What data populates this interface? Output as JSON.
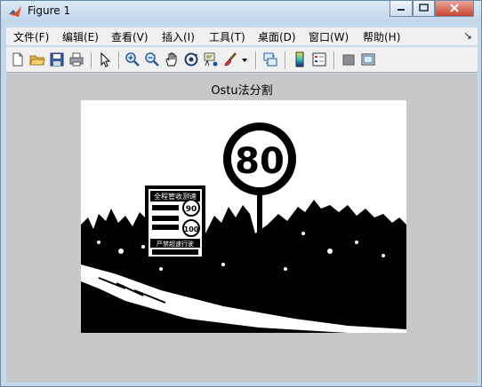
{
  "window": {
    "title": "Figure 1"
  },
  "menu": [
    "文件(F)",
    "编辑(E)",
    "查看(V)",
    "插入(I)",
    "工具(T)",
    "桌面(D)",
    "窗口(W)",
    "帮助(H)"
  ],
  "toolbar_icons": [
    "new-figure-icon",
    "open-file-icon",
    "save-icon",
    "print-icon",
    "edit-plot-icon",
    "zoom-in-icon",
    "zoom-out-icon",
    "pan-icon",
    "rotate-3d-icon",
    "data-cursor-icon",
    "brush-icon",
    "brush-dropdown-icon",
    "link-plot-icon",
    "insert-colorbar-icon",
    "insert-legend-icon",
    "hide-plot-tools-icon",
    "show-plot-tools-icon"
  ],
  "plot": {
    "title": "Ostu法分割",
    "sign_speed": "80",
    "billboard_lines": [
      "全程管收测速",
      "90",
      "100",
      "严禁超速行驶"
    ]
  }
}
